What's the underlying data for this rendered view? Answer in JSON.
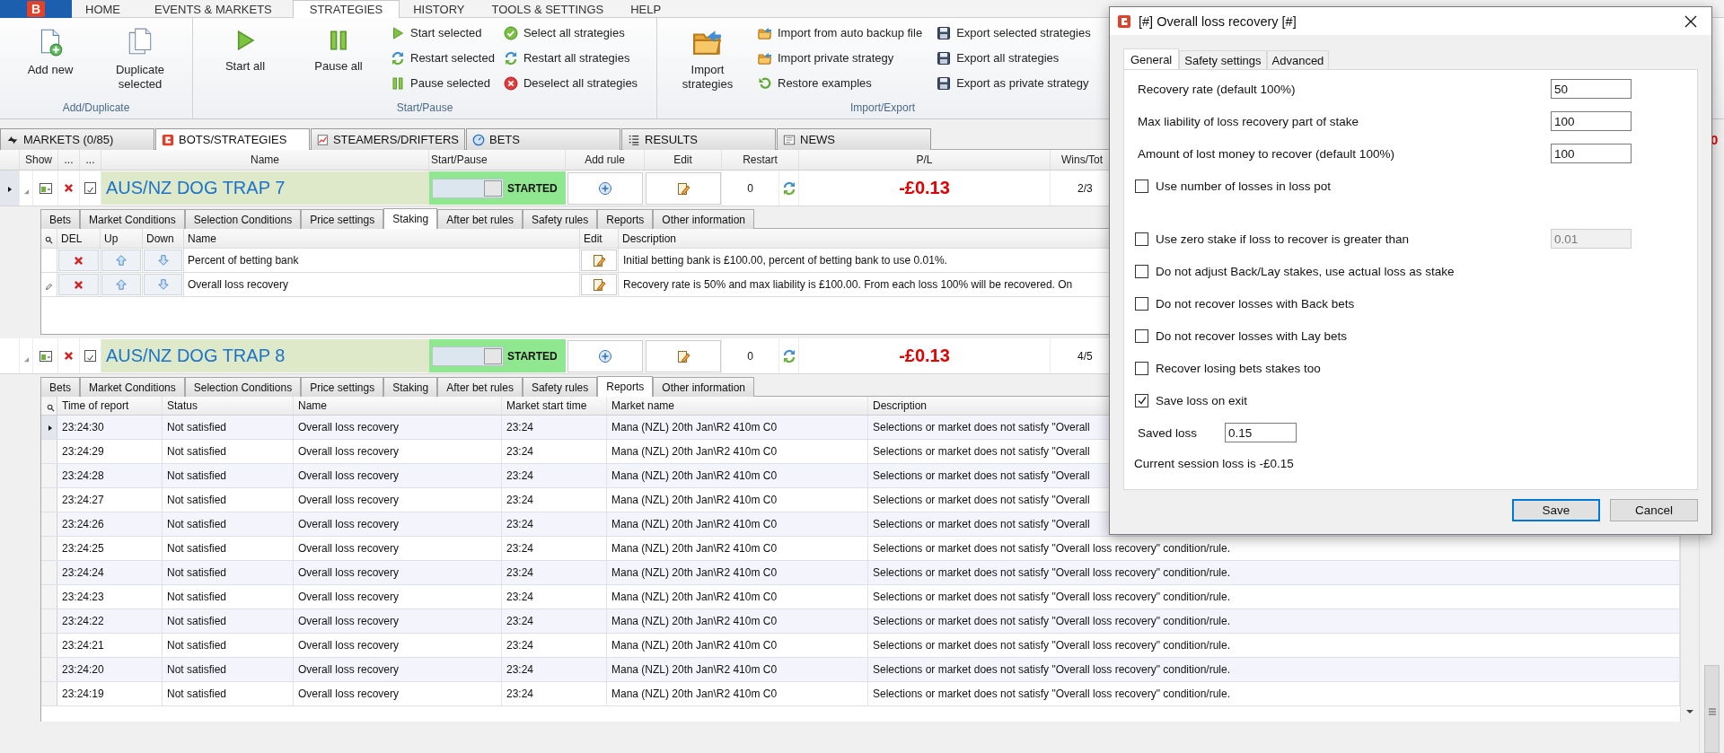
{
  "app": {
    "logo": "B",
    "tabs": [
      {
        "label": "HOME",
        "selected": false
      },
      {
        "label": "EVENTS & MARKETS",
        "selected": false
      },
      {
        "label": "STRATEGIES",
        "selected": true
      },
      {
        "label": "HISTORY",
        "selected": false
      },
      {
        "label": "TOOLS & SETTINGS",
        "selected": false
      },
      {
        "label": "HELP",
        "selected": false
      }
    ]
  },
  "ribbon": {
    "groups": [
      {
        "label": "Add/Duplicate",
        "large": [
          "Add new",
          "Duplicate selected"
        ]
      },
      {
        "label": "Start/Pause",
        "large": [
          "Start all",
          "Pause all"
        ],
        "columns": [
          [
            "Start selected",
            "Restart selected",
            "Pause selected"
          ],
          [
            "Select all strategies",
            "Restart all strategies",
            "Deselect all strategies"
          ]
        ]
      },
      {
        "label": "Import/Export",
        "large": [
          "Import strategies"
        ],
        "columns": [
          [
            "Import from auto backup file",
            "Import private strategy",
            "Restore examples"
          ],
          [
            "Export selected strategies",
            "Export all strategies",
            "Export as private strategy"
          ]
        ]
      }
    ]
  },
  "views": {
    "tabs": [
      {
        "label": "MARKETS (0/85)",
        "selected": false
      },
      {
        "label": "BOTS/STRATEGIES",
        "selected": true
      },
      {
        "label": "STEAMERS/DRIFTERS",
        "selected": false
      },
      {
        "label": "BETS",
        "selected": false
      },
      {
        "label": "RESULTS",
        "selected": false
      },
      {
        "label": "NEWS",
        "selected": false
      }
    ],
    "edge_text": "0"
  },
  "strategies": {
    "columns": [
      "Show",
      "...",
      "...",
      "Name",
      "Start/Pause",
      "Add rule",
      "Edit",
      "Restart",
      "P/L",
      "Wins/Tot"
    ],
    "rows": [
      {
        "selected": true,
        "expanded": true,
        "shown": true,
        "enabled": true,
        "name": "AUS/NZ DOG TRAP 7",
        "running": true,
        "status": "STARTED",
        "restart": "0",
        "pl": "-£0.13",
        "wins": "2/3",
        "detail": {
          "kind": "staking",
          "tabs": [
            {
              "label": "Bets",
              "selected": false
            },
            {
              "label": "Market Conditions",
              "selected": false
            },
            {
              "label": "Selection Conditions",
              "selected": false
            },
            {
              "label": "Price settings",
              "selected": false
            },
            {
              "label": "Staking",
              "selected": true
            },
            {
              "label": "After bet rules",
              "selected": false
            },
            {
              "label": "Safety rules",
              "selected": false
            },
            {
              "label": "Reports",
              "selected": false
            },
            {
              "label": "Other information",
              "selected": false
            }
          ],
          "columns": [
            "DEL",
            "Up",
            "Down",
            "Name",
            "Edit",
            "Description"
          ],
          "rows": [
            {
              "editing": false,
              "name": "Percent of betting bank",
              "description": "Initial betting bank is £100.00, percent of betting bank to use 0.01%."
            },
            {
              "editing": true,
              "name": "Overall loss recovery",
              "description": "Recovery rate is 50% and max liability is £100.00. From each loss 100% will be recovered. On"
            }
          ]
        }
      },
      {
        "selected": false,
        "expanded": true,
        "shown": true,
        "enabled": true,
        "name": "AUS/NZ DOG TRAP 8",
        "running": true,
        "status": "STARTED",
        "restart": "0",
        "pl": "-£0.13",
        "wins": "4/5",
        "detail": {
          "kind": "reports",
          "tabs": [
            {
              "label": "Bets",
              "selected": false
            },
            {
              "label": "Market Conditions",
              "selected": false
            },
            {
              "label": "Selection Conditions",
              "selected": false
            },
            {
              "label": "Price settings",
              "selected": false
            },
            {
              "label": "Staking",
              "selected": false
            },
            {
              "label": "After bet rules",
              "selected": false
            },
            {
              "label": "Safety rules",
              "selected": false
            },
            {
              "label": "Reports",
              "selected": true
            },
            {
              "label": "Other information",
              "selected": false
            }
          ],
          "columns": [
            "Time of report",
            "Status",
            "Name",
            "Market start time",
            "Market name",
            "Description"
          ],
          "rows": [
            {
              "selected": true,
              "time": "23:24:30",
              "status": "Not satisfied",
              "name": "Overall loss recovery",
              "start": "23:24",
              "market": "Mana (NZL) 20th Jan\\R2 410m C0",
              "description": "Selections or market does not satisfy \"Overall"
            },
            {
              "selected": false,
              "time": "23:24:29",
              "status": "Not satisfied",
              "name": "Overall loss recovery",
              "start": "23:24",
              "market": "Mana (NZL) 20th Jan\\R2 410m C0",
              "description": "Selections or market does not satisfy \"Overall"
            },
            {
              "selected": false,
              "time": "23:24:28",
              "status": "Not satisfied",
              "name": "Overall loss recovery",
              "start": "23:24",
              "market": "Mana (NZL) 20th Jan\\R2 410m C0",
              "description": "Selections or market does not satisfy \"Overall"
            },
            {
              "selected": false,
              "time": "23:24:27",
              "status": "Not satisfied",
              "name": "Overall loss recovery",
              "start": "23:24",
              "market": "Mana (NZL) 20th Jan\\R2 410m C0",
              "description": "Selections or market does not satisfy \"Overall"
            },
            {
              "selected": false,
              "time": "23:24:26",
              "status": "Not satisfied",
              "name": "Overall loss recovery",
              "start": "23:24",
              "market": "Mana (NZL) 20th Jan\\R2 410m C0",
              "description": "Selections or market does not satisfy \"Overall"
            },
            {
              "selected": false,
              "time": "23:24:25",
              "status": "Not satisfied",
              "name": "Overall loss recovery",
              "start": "23:24",
              "market": "Mana (NZL) 20th Jan\\R2 410m C0",
              "description": "Selections or market does not satisfy \"Overall loss recovery\" condition/rule."
            },
            {
              "selected": false,
              "time": "23:24:24",
              "status": "Not satisfied",
              "name": "Overall loss recovery",
              "start": "23:24",
              "market": "Mana (NZL) 20th Jan\\R2 410m C0",
              "description": "Selections or market does not satisfy \"Overall loss recovery\" condition/rule."
            },
            {
              "selected": false,
              "time": "23:24:23",
              "status": "Not satisfied",
              "name": "Overall loss recovery",
              "start": "23:24",
              "market": "Mana (NZL) 20th Jan\\R2 410m C0",
              "description": "Selections or market does not satisfy \"Overall loss recovery\" condition/rule."
            },
            {
              "selected": false,
              "time": "23:24:22",
              "status": "Not satisfied",
              "name": "Overall loss recovery",
              "start": "23:24",
              "market": "Mana (NZL) 20th Jan\\R2 410m C0",
              "description": "Selections or market does not satisfy \"Overall loss recovery\" condition/rule."
            },
            {
              "selected": false,
              "time": "23:24:21",
              "status": "Not satisfied",
              "name": "Overall loss recovery",
              "start": "23:24",
              "market": "Mana (NZL) 20th Jan\\R2 410m C0",
              "description": "Selections or market does not satisfy \"Overall loss recovery\" condition/rule."
            },
            {
              "selected": false,
              "time": "23:24:20",
              "status": "Not satisfied",
              "name": "Overall loss recovery",
              "start": "23:24",
              "market": "Mana (NZL) 20th Jan\\R2 410m C0",
              "description": "Selections or market does not satisfy \"Overall loss recovery\" condition/rule."
            },
            {
              "selected": false,
              "time": "23:24:19",
              "status": "Not satisfied",
              "name": "Overall loss recovery",
              "start": "23:24",
              "market": "Mana (NZL) 20th Jan\\R2 410m C0",
              "description": "Selections or market does not satisfy \"Overall loss recovery\" condition/rule."
            }
          ]
        }
      }
    ]
  },
  "dialog": {
    "title": "[#] Overall loss recovery [#]",
    "tabs": [
      {
        "label": "General",
        "selected": true
      },
      {
        "label": "Safety settings",
        "selected": false
      },
      {
        "label": "Advanced",
        "selected": false
      }
    ],
    "items": [
      {
        "kind": "input",
        "label": "Recovery rate (default 100%)",
        "value": "50"
      },
      {
        "kind": "input",
        "label": "Max liability of loss recovery part of stake",
        "value": "100"
      },
      {
        "kind": "input",
        "label": "Amount of lost money to recover (default 100%)",
        "value": "100"
      },
      {
        "kind": "checkbox",
        "label": "Use number of losses in loss pot",
        "checked": false
      },
      {
        "kind": "checkbox",
        "label": "Use zero stake if loss to recover is greater than",
        "checked": false,
        "value": "0.01",
        "disabled": true
      },
      {
        "kind": "checkbox",
        "label": "Do not adjust Back/Lay stakes, use actual loss as stake",
        "checked": false
      },
      {
        "kind": "checkbox",
        "label": "Do not recover losses with Back bets",
        "checked": false
      },
      {
        "kind": "checkbox",
        "label": "Do not recover losses with Lay bets",
        "checked": false
      },
      {
        "kind": "checkbox",
        "label": "Recover losing bets stakes too",
        "checked": false
      },
      {
        "kind": "checkbox",
        "label": "Save loss on exit",
        "checked": true
      },
      {
        "kind": "short_input",
        "label": "Saved loss",
        "value": "0.15"
      },
      {
        "kind": "text",
        "label": "Current session loss is -£0.15"
      }
    ],
    "buttons": [
      {
        "label": "Save",
        "default": true
      },
      {
        "label": "Cancel",
        "default": false
      }
    ]
  }
}
